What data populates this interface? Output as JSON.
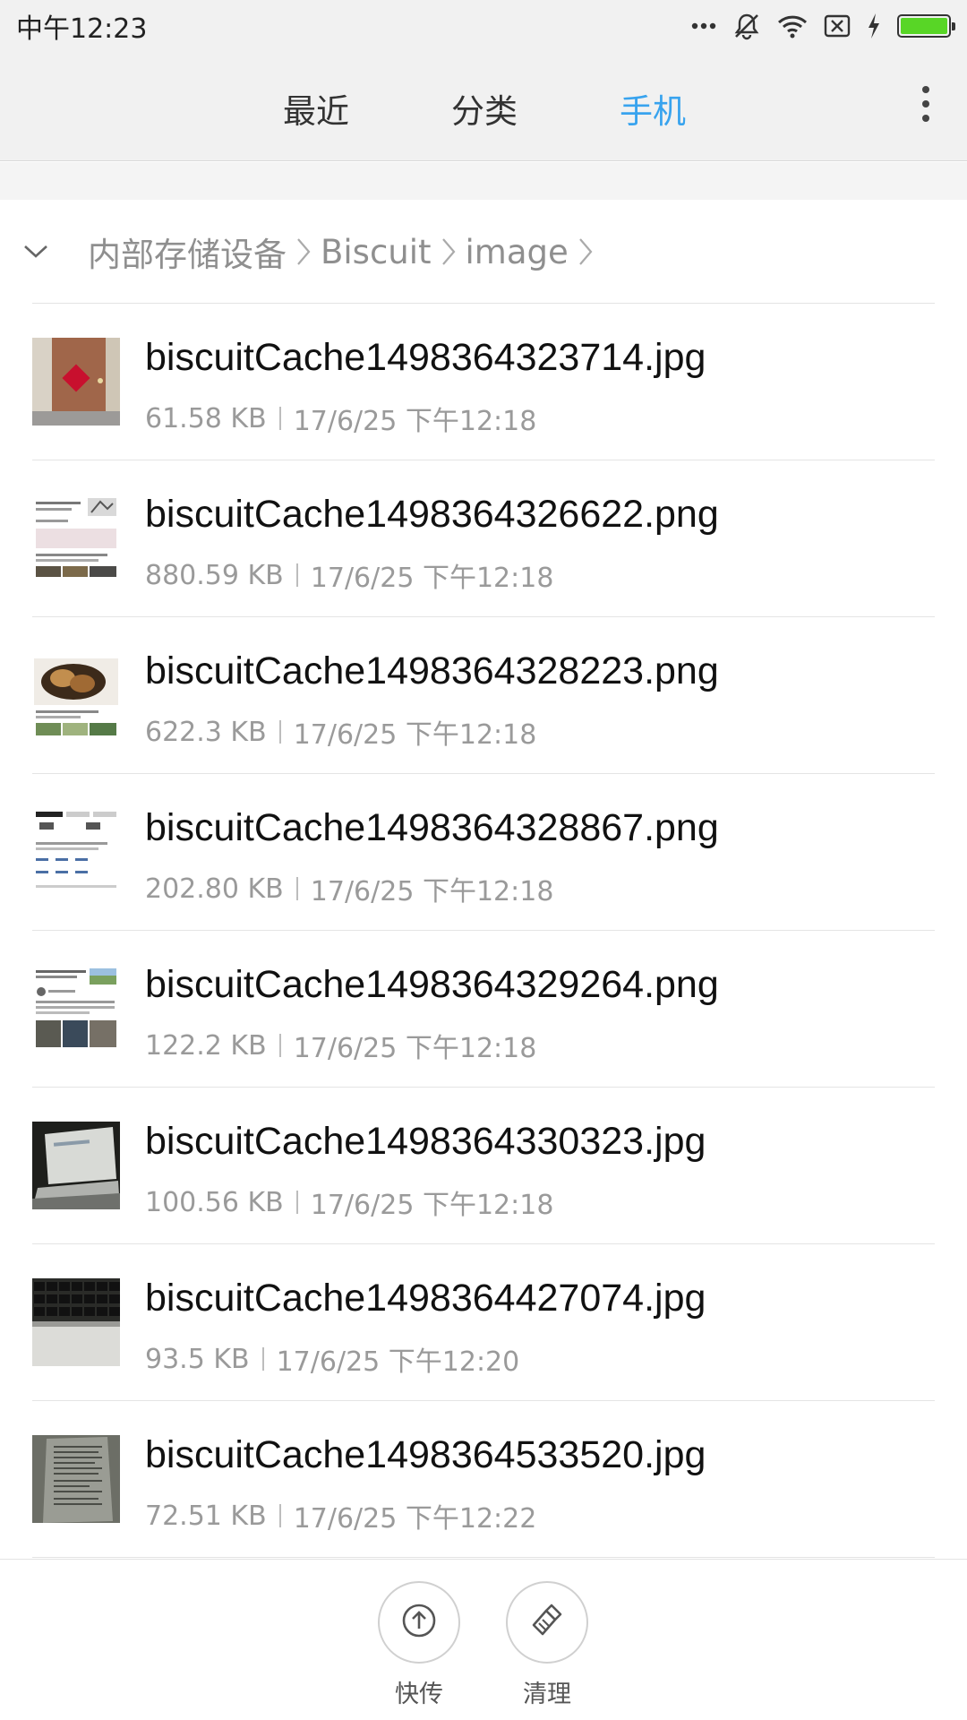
{
  "status_bar": {
    "time": "中午12:23",
    "icons": [
      "more-dots-icon",
      "vibrate-off-icon",
      "wifi-icon",
      "sim-none-icon",
      "charging-icon",
      "battery-icon"
    ],
    "battery_level": 1.0,
    "battery_color": "#58d626"
  },
  "tabs": [
    {
      "label": "最近",
      "active": false
    },
    {
      "label": "分类",
      "active": false
    },
    {
      "label": "手机",
      "active": true
    }
  ],
  "accent_color": "#38a3ee",
  "breadcrumb": {
    "items": [
      "内部存储设备",
      "Biscuit",
      "image"
    ]
  },
  "files": [
    {
      "name": "biscuitCache1498364323714.jpg",
      "size": "61.58 KB",
      "date": "17/6/25 下午12:18",
      "thumb": "photo-door"
    },
    {
      "name": "biscuitCache1498364326622.png",
      "size": "880.59 KB",
      "date": "17/6/25 下午12:18",
      "thumb": "screenshot-article"
    },
    {
      "name": "biscuitCache1498364328223.png",
      "size": "622.3 KB",
      "date": "17/6/25 下午12:18",
      "thumb": "screenshot-food"
    },
    {
      "name": "biscuitCache1498364328867.png",
      "size": "202.80 KB",
      "date": "17/6/25 下午12:18",
      "thumb": "screenshot-table"
    },
    {
      "name": "biscuitCache1498364329264.png",
      "size": "122.2 KB",
      "date": "17/6/25 下午12:18",
      "thumb": "screenshot-news"
    },
    {
      "name": "biscuitCache1498364330323.jpg",
      "size": "100.56 KB",
      "date": "17/6/25 下午12:18",
      "thumb": "photo-laptop"
    },
    {
      "name": "biscuitCache1498364427074.jpg",
      "size": "93.5 KB",
      "date": "17/6/25 下午12:20",
      "thumb": "photo-keyboard"
    },
    {
      "name": "biscuitCache1498364533520.jpg",
      "size": "72.51 KB",
      "date": "17/6/25 下午12:22",
      "thumb": "photo-document"
    }
  ],
  "bottom_actions": [
    {
      "label": "快传",
      "icon": "upload-arrow-icon"
    },
    {
      "label": "清理",
      "icon": "broom-icon"
    }
  ]
}
